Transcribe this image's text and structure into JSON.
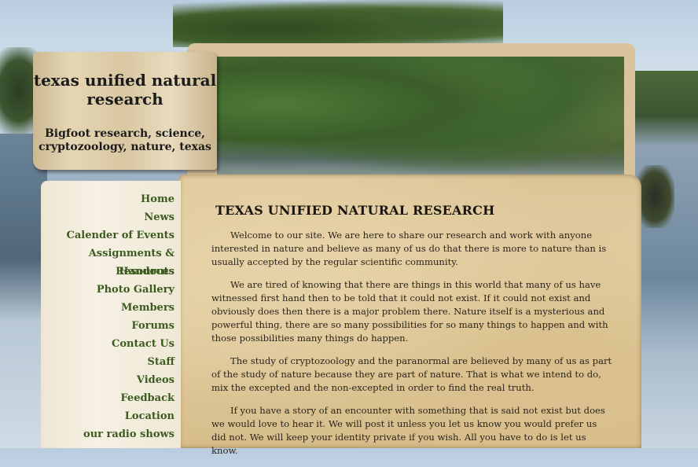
{
  "header": {
    "title": "texas unified natural research",
    "tagline": "Bigfoot research, science, cryptozoology, nature, texas"
  },
  "nav": {
    "items": [
      "Home",
      "News",
      "Calender of Events",
      "Assignments & Handouts",
      "Resources",
      "Photo Gallery",
      "Members",
      "Forums",
      "Contact Us",
      "Staff",
      "Videos",
      "Feedback",
      "Location",
      "our radio shows"
    ]
  },
  "main": {
    "heading": "TEXAS UNIFIED NATURAL RESEARCH",
    "paragraphs": [
      "Welcome to our site. We are here to share our research and work with anyone interested in nature and believe as many of us do that there is more to nature than is usually accepted by the regular scientific community.",
      "We are tired of knowing that there are things in this world that many of us have witnessed first hand then to be told that it could not exist. If it could not exist and obviously does then there is a major problem there. Nature itself is a mysterious and powerful thing, there are so many possibilities for so many things to happen and with those possibilities many things do happen.",
      "The study of cryptozoology  and the paranormal are believed by many of us as part of the study of nature because they are part of nature. That is what we intend to do, mix  the excepted and the non-excepted in order to find the real truth.",
      "If you have a story of an encounter with something that is said not exist but does we would love to hear it. We will post it unless you let us know you would prefer us did not. We will keep your identity private if you wish. All you have to do is let us know."
    ]
  },
  "colors": {
    "nav_text": "#3c5b1f",
    "parchment": "#dcc597",
    "plank": "#e6d6b4"
  }
}
